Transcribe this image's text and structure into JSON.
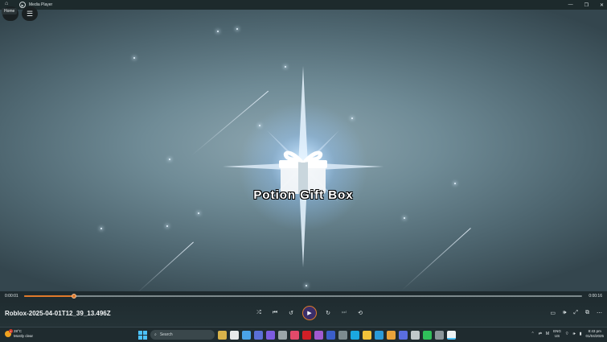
{
  "window": {
    "title": "Media Player",
    "buttons": {
      "minimize": "—",
      "maximize": "❐",
      "close": "✕"
    }
  },
  "tooltip": {
    "home": "Home"
  },
  "video": {
    "caption": "Potion Gift Box"
  },
  "player": {
    "elapsed": "0:00:01",
    "duration": "0:00:16",
    "progress_fraction": 0.09,
    "filename": "Roblox-2025-04-01T12_39_13.496Z",
    "accent_color": "#e07a2b"
  },
  "taskbar": {
    "weather_temp": "28°C",
    "weather_desc": "Mostly clear",
    "weather_badge": "1",
    "search_placeholder": "Search",
    "lang_line1": "ENG",
    "lang_line2": "US",
    "time": "8:43 pm",
    "date": "01/04/2025"
  }
}
